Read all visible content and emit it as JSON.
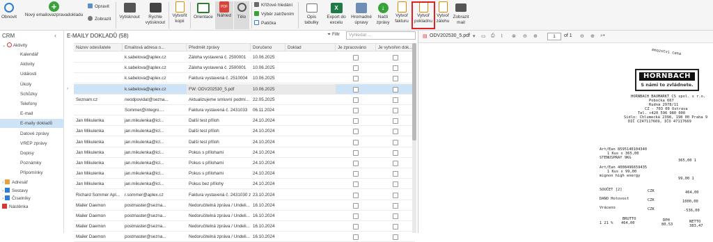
{
  "ribbon": {
    "refresh": "Obnovit",
    "new_doc": "Nový emailovazpravadokladu",
    "edit": "Opravit",
    "show": "Zobrazit",
    "print": "Vytisknout",
    "quick_print": "Rychle vytisknout",
    "print_copy": "Vytvořit kopii",
    "orientation": "Orientace",
    "preview": "Náhled",
    "body": "Tělo",
    "cross_search": "Křížové hledání",
    "sums": "Výběr zatržením",
    "footer": "Patička",
    "table_desc": "Opis tabulky",
    "export_excel": "Export do excelu",
    "bulk_edit": "Hromadné úpravy",
    "load_messages": "Načti zprávy",
    "create_invoice": "Vytvoř fakturu",
    "create_receipt": "Vytvoř pokladnu",
    "create_deposit": "Vytvoř zálohu",
    "show_mail": "Zobrazit mail"
  },
  "sidebar": {
    "title": "CRM",
    "group": "Aktivity",
    "items": [
      "Kalendář",
      "Aktivity",
      "Události",
      "Úkoly",
      "Schůzky",
      "Telefony",
      "E-mail",
      "E-maily dokladů",
      "Datové zprávy",
      "VREP zprávy",
      "Dopisy",
      "Poznámky",
      "Připomínky"
    ],
    "bottom": [
      "Adresář",
      "Sestavy",
      "Číselníky",
      "Nástěnka"
    ]
  },
  "main": {
    "title": "E-MAILY DOKLADŮ (58)",
    "filter": "Filtr",
    "search_placeholder": "Vyhledat ...",
    "columns": [
      "Název odesílatele",
      "Emailová adresa o...",
      "Předmět zprávy",
      "Doručeno",
      "Doklad",
      "Je zpracováno",
      "Je vytvořen dok..."
    ],
    "rows": [
      [
        "",
        "k.sabelova@aplex.cz",
        "Záloha vystavená č. 2500001",
        "10.06.2025",
        ""
      ],
      [
        "",
        "k.sabelova@aplex.cz",
        "Záloha vystavená č. 2500001",
        "10.06.2025",
        ""
      ],
      [
        "",
        "k.sabelova@aplex.cz",
        "Faktura vystavená č. 2510004",
        "10.06.2025",
        ""
      ],
      [
        "",
        "k.sabelova@aplex.cz",
        "FW: ODV202530_5.pdf",
        "10.06.2025",
        ""
      ],
      [
        "Seznam.cz",
        "neodpovidat@sezna...",
        "Aktualizujeme smluvní podmí...",
        "22.05.2025",
        ""
      ],
      [
        "",
        "Sommer@integro....",
        "Faktura vystavená č. 2431033",
        "06.11.2024",
        ""
      ],
      [
        "Jan Mikulenka",
        "jan.mikulenka@icl...",
        "Další test příloh",
        "24.10.2024",
        ""
      ],
      [
        "Jan Mikulenka",
        "jan.mikulenka@icl...",
        "Další test příloh",
        "24.10.2024",
        ""
      ],
      [
        "Jan Mikulenka",
        "jan.mikulenka@icl...",
        "Další test příloh",
        "24.10.2024",
        ""
      ],
      [
        "Jan Mikulenka",
        "jan.mikulenka@icl...",
        "Pokus s přílohami",
        "24.10.2024",
        ""
      ],
      [
        "Jan Mikulenka",
        "jan.mikulenka@icl...",
        "Pokus s přílohami",
        "24.10.2024",
        ""
      ],
      [
        "Jan Mikulenka",
        "jan.mikulenka@icl...",
        "Pokus s přílohami",
        "24.10.2024",
        ""
      ],
      [
        "Jan Mikulenka",
        "jan.mikulenka@icl...",
        "Pokus bez přílohy",
        "24.10.2024",
        ""
      ],
      [
        "Richard Sommer Apl...",
        "r.sommer@aplex.cz",
        "Faktura vystavená č. 2431030 z...",
        "23.10.2024",
        ""
      ],
      [
        "Mailer Daemon",
        "postmaster@sezna...",
        "Nedoručitelná zpráva / Undeli...",
        "16.10.2024",
        ""
      ],
      [
        "Mailer Daemon",
        "postmaster@sezna...",
        "Nedoručitelná zpráva / Undeli...",
        "16.10.2024",
        ""
      ],
      [
        "Mailer Daemon",
        "postmaster@sezna...",
        "Nedoručitelná zpráva / Undeli...",
        "16.10.2024",
        ""
      ],
      [
        "Mailer Daemon",
        "postmaster@sezna...",
        "Nedoručitelná zpráva / Undeli...",
        "16.10.2024",
        ""
      ]
    ]
  },
  "preview": {
    "file": "ODV202530_5.pdf",
    "page": "1",
    "of": "of 1",
    "receipt": {
      "top": "mnozstvi cena",
      "logo": "HORNBACH",
      "slogan": "S námi to zvládnete.",
      "addr1": "HORNBACH BAUMARKT CS spol. s r.o.",
      "addr2": "Pobočka 667",
      "addr3": "Rudná 2978/11",
      "addr4": "CZ - 703 00 Ostrava",
      "addr5": "Tel. +420 596 980 000",
      "addr6": "Sídlo: Chlumecká 2398, 198 00 Praha 9",
      "addr7": "DIČ CZ47117669, IČO 47117669",
      "item1a": "Art/Ean 8595140104340",
      "item1b": "1 Kus   x    365,00",
      "item1c": "STENUSPRAY 9KG",
      "item1d": "365,00 1",
      "item2a": "Art/Ean 4008496659435",
      "item2b": "1 Kus   x    99,00",
      "item2c": "mignon high energy",
      "item2d": "99,00 1",
      "sum_label": "SOUČET  [2]",
      "sum_cur": "CZK",
      "sum_val": "464,00",
      "cash_label": "DANO Hotovost",
      "cash_cur": "CZK",
      "cash_val": "1000,00",
      "back_label": "Vráceno",
      "back_cur": "CZK",
      "back_val": "-536,00",
      "vat_hdr1": "BRUTTO",
      "vat_hdr2": "DPH",
      "vat_hdr3": "NETTO",
      "vat_rate": "1 21 %",
      "vat_b": "464,00",
      "vat_d": "80,53",
      "vat_n": "383,47"
    }
  },
  "colors": {
    "accent": "#e02020",
    "selected": "#cfe3f7"
  }
}
